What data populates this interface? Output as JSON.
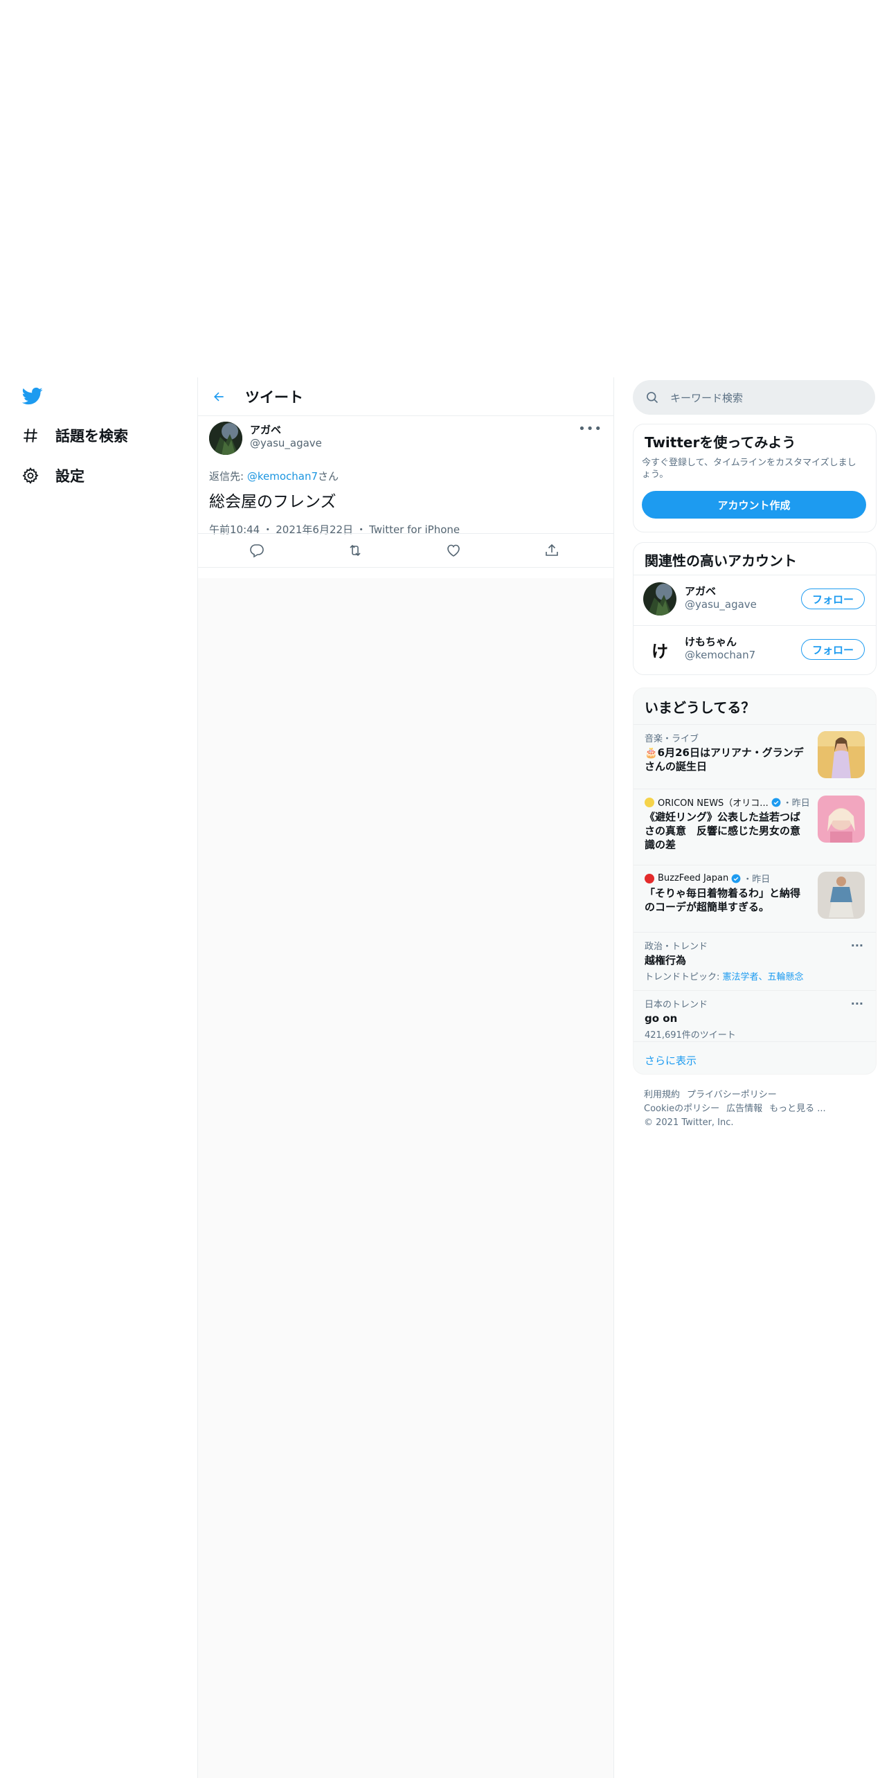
{
  "nav": {
    "explore_label": "話題を検索",
    "settings_label": "設定"
  },
  "main": {
    "title": "ツイート",
    "tweet": {
      "author_name": "アガベ",
      "author_handle": "@yasu_agave",
      "reply_prefix": "返信先: ",
      "reply_mention": "@kemochan7",
      "reply_suffix": "さん",
      "text": "総会屋のフレンズ",
      "time": "午前10:44",
      "date": "2021年6月22日",
      "source": "Twitter for iPhone",
      "meta_separator": "・"
    }
  },
  "search": {
    "placeholder": "キーワード検索"
  },
  "signup": {
    "title": "Twitterを使ってみよう",
    "description": "今すぐ登録して、タイムラインをカスタマイズしましょう。",
    "button": "アカウント作成"
  },
  "related": {
    "title": "関連性の高いアカウント",
    "accounts": [
      {
        "name": "アガベ",
        "handle": "@yasu_agave",
        "follow": "フォロー"
      },
      {
        "name": "けもちゃん",
        "handle": "@kemochan7",
        "follow": "フォロー",
        "avatar_text": "け"
      }
    ]
  },
  "trends": {
    "title": "いまどうしてる？",
    "items": [
      {
        "category": "音楽・ライブ",
        "title": "🎂6月26日はアリアナ・グランデさんの誕生日"
      },
      {
        "source": "ORICON NEWS（オリコ...",
        "when": "・昨日",
        "title": "《避妊リング》公表した益若つばさの真意　反響に感じた男女の意識の差"
      },
      {
        "source": "BuzzFeed Japan",
        "when": "・昨日",
        "title": "「そりゃ毎日着物着るわ」と納得のコーデが超簡単すぎる。"
      },
      {
        "category": "政治・トレンド",
        "title": "越権行為",
        "sub_prefix": "トレンドトピック: ",
        "sub_links": "憲法学者、五輪懸念"
      },
      {
        "category": "日本のトレンド",
        "title": "go on",
        "sub": "421,691件のツイート"
      }
    ],
    "show_more": "さらに表示"
  },
  "footer": {
    "links": [
      "利用規約",
      "プライバシーポリシー",
      "Cookieのポリシー",
      "広告情報",
      "もっと見る ..."
    ],
    "copyright": "© 2021 Twitter, Inc."
  },
  "colors": {
    "accent": "#1d9bf0",
    "muted": "#536471",
    "border": "#ebeef0"
  }
}
